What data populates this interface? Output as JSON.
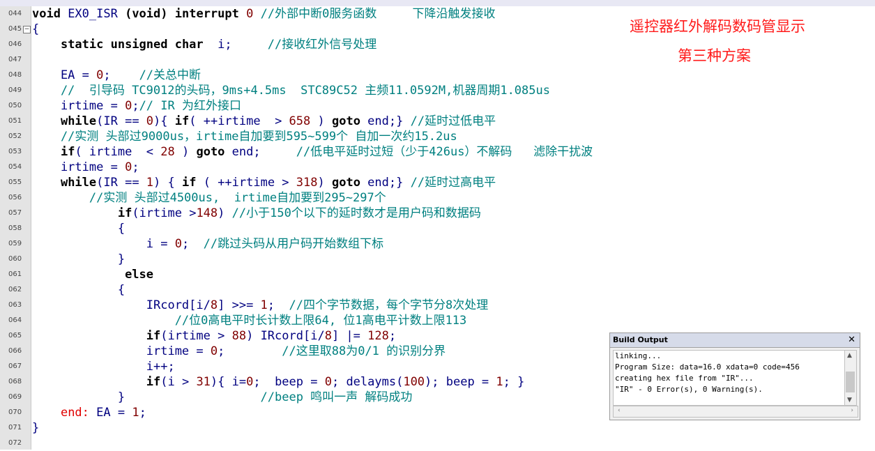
{
  "editor": {
    "lines": [
      {
        "ln": "044",
        "segs": [
          [
            "kw",
            "void"
          ],
          [
            "p",
            " EX0_ISR "
          ],
          [
            "kw",
            "(void)"
          ],
          [
            "p",
            " "
          ],
          [
            "kw",
            "interrupt"
          ],
          [
            "p",
            " "
          ],
          [
            "num",
            "0"
          ],
          [
            "p",
            " "
          ],
          [
            "cm",
            "//外部中断0服务函数     下降沿触发接收"
          ]
        ]
      },
      {
        "ln": "045",
        "fold": "−",
        "segs": [
          [
            "p",
            "{"
          ]
        ]
      },
      {
        "ln": "046",
        "segs": [
          [
            "p",
            "    "
          ],
          [
            "kw",
            "static unsigned char"
          ],
          [
            "p",
            "  i;     "
          ],
          [
            "cm",
            "//接收红外信号处理"
          ]
        ]
      },
      {
        "ln": "047",
        "segs": []
      },
      {
        "ln": "048",
        "segs": [
          [
            "p",
            "    EA = "
          ],
          [
            "num",
            "0"
          ],
          [
            "p",
            ";    "
          ],
          [
            "cm",
            "//关总中断"
          ]
        ]
      },
      {
        "ln": "049",
        "segs": [
          [
            "cm",
            "    //  引导码 TC9012的头码，9ms+4.5ms  STC89C52 主频11.0592M,机器周期1.085us"
          ]
        ]
      },
      {
        "ln": "050",
        "segs": [
          [
            "p",
            "    irtime = "
          ],
          [
            "num",
            "0"
          ],
          [
            "p",
            ";"
          ],
          [
            "cm",
            "// IR 为红外接口"
          ]
        ]
      },
      {
        "ln": "051",
        "segs": [
          [
            "p",
            "    "
          ],
          [
            "kw",
            "while"
          ],
          [
            "p",
            "(IR == "
          ],
          [
            "num",
            "0"
          ],
          [
            "p",
            "){ "
          ],
          [
            "kw",
            "if"
          ],
          [
            "p",
            "( ++irtime  > "
          ],
          [
            "num",
            "658"
          ],
          [
            "p",
            " ) "
          ],
          [
            "kw",
            "goto"
          ],
          [
            "p",
            " end;} "
          ],
          [
            "cm",
            "//延时过低电平"
          ]
        ]
      },
      {
        "ln": "052",
        "segs": [
          [
            "cm",
            "    //实测 头部过9000us，irtime自加要到595~599个 自加一次约15.2us"
          ]
        ]
      },
      {
        "ln": "053",
        "segs": [
          [
            "p",
            "    "
          ],
          [
            "kw",
            "if"
          ],
          [
            "p",
            "( irtime  < "
          ],
          [
            "num",
            "28"
          ],
          [
            "p",
            " ) "
          ],
          [
            "kw",
            "goto"
          ],
          [
            "p",
            " end;     "
          ],
          [
            "cm",
            "//低电平延时过短（少于426us）不解码   滤除干扰波"
          ]
        ]
      },
      {
        "ln": "054",
        "segs": [
          [
            "p",
            "    irtime = "
          ],
          [
            "num",
            "0"
          ],
          [
            "p",
            ";"
          ]
        ]
      },
      {
        "ln": "055",
        "segs": [
          [
            "p",
            "    "
          ],
          [
            "kw",
            "while"
          ],
          [
            "p",
            "(IR == "
          ],
          [
            "num",
            "1"
          ],
          [
            "p",
            ") { "
          ],
          [
            "kw",
            "if"
          ],
          [
            "p",
            " ( ++irtime > "
          ],
          [
            "num",
            "318"
          ],
          [
            "p",
            ") "
          ],
          [
            "kw",
            "goto"
          ],
          [
            "p",
            " end;} "
          ],
          [
            "cm",
            "//延时过高电平"
          ]
        ]
      },
      {
        "ln": "056",
        "segs": [
          [
            "cm",
            "        //实测 头部过4500us,  irtime自加要到295~297个"
          ]
        ]
      },
      {
        "ln": "057",
        "segs": [
          [
            "p",
            "            "
          ],
          [
            "kw",
            "if"
          ],
          [
            "p",
            "(irtime >"
          ],
          [
            "num",
            "148"
          ],
          [
            "p",
            ") "
          ],
          [
            "cm",
            "//小于150个以下的延时数才是用户码和数据码"
          ]
        ]
      },
      {
        "ln": "058",
        "segs": [
          [
            "p",
            "            {"
          ]
        ]
      },
      {
        "ln": "059",
        "segs": [
          [
            "p",
            "                i = "
          ],
          [
            "num",
            "0"
          ],
          [
            "p",
            ";  "
          ],
          [
            "cm",
            "//跳过头码从用户码开始数组下标"
          ]
        ]
      },
      {
        "ln": "060",
        "segs": [
          [
            "p",
            "            }"
          ]
        ]
      },
      {
        "ln": "061",
        "segs": [
          [
            "p",
            "             "
          ],
          [
            "kw",
            "else"
          ]
        ]
      },
      {
        "ln": "062",
        "segs": [
          [
            "p",
            "            {"
          ]
        ]
      },
      {
        "ln": "063",
        "segs": [
          [
            "p",
            "                IRcord[i/"
          ],
          [
            "num",
            "8"
          ],
          [
            "p",
            "] >>= "
          ],
          [
            "num",
            "1"
          ],
          [
            "p",
            ";  "
          ],
          [
            "cm",
            "//四个字节数据，每个字节分8次处理"
          ]
        ]
      },
      {
        "ln": "064",
        "segs": [
          [
            "cm",
            "                    //位0高电平时长计数上限64, 位1高电平计数上限113"
          ]
        ]
      },
      {
        "ln": "065",
        "segs": [
          [
            "p",
            "                "
          ],
          [
            "kw",
            "if"
          ],
          [
            "p",
            "(irtime > "
          ],
          [
            "num",
            "88"
          ],
          [
            "p",
            ") IRcord[i/"
          ],
          [
            "num",
            "8"
          ],
          [
            "p",
            "] |= "
          ],
          [
            "num",
            "128"
          ],
          [
            "p",
            ";"
          ]
        ]
      },
      {
        "ln": "066",
        "segs": [
          [
            "p",
            "                irtime = "
          ],
          [
            "num",
            "0"
          ],
          [
            "p",
            ";        "
          ],
          [
            "cm",
            "//这里取88为0/1 的识别分界"
          ]
        ]
      },
      {
        "ln": "067",
        "segs": [
          [
            "p",
            "                i++;"
          ]
        ]
      },
      {
        "ln": "068",
        "segs": [
          [
            "p",
            "                "
          ],
          [
            "kw",
            "if"
          ],
          [
            "p",
            "(i > "
          ],
          [
            "num",
            "31"
          ],
          [
            "p",
            "){ i="
          ],
          [
            "num",
            "0"
          ],
          [
            "p",
            ";  beep = "
          ],
          [
            "num",
            "0"
          ],
          [
            "p",
            "; delayms("
          ],
          [
            "num",
            "100"
          ],
          [
            "p",
            "); beep = "
          ],
          [
            "num",
            "1"
          ],
          [
            "p",
            "; }"
          ]
        ]
      },
      {
        "ln": "069",
        "segs": [
          [
            "p",
            "            }                   "
          ],
          [
            "cm",
            "//beep 鸣叫一声 解码成功"
          ]
        ]
      },
      {
        "ln": "070",
        "segs": [
          [
            "p",
            "    "
          ],
          [
            "lbl",
            "end:"
          ],
          [
            "p",
            " EA = "
          ],
          [
            "num",
            "1"
          ],
          [
            "p",
            ";"
          ]
        ]
      },
      {
        "ln": "071",
        "segs": [
          [
            "p",
            "}"
          ]
        ]
      },
      {
        "ln": "072",
        "segs": []
      }
    ]
  },
  "annotation": {
    "line1": "遥控器红外解码数码管显示",
    "line2": "第三种方案"
  },
  "build_output": {
    "title": "Build Output",
    "close_icon": "close-icon",
    "lines": [
      "linking...",
      "Program Size: data=16.0 xdata=0 code=456",
      "creating hex file from \"IR\"...",
      "\"IR\" - 0 Error(s), 0 Warning(s)."
    ]
  },
  "colors": {
    "keyword": "#000000",
    "identifier": "#000080",
    "number": "#800000",
    "comment": "#008080",
    "label": "#e00000",
    "annotation": "#ff1a1a"
  }
}
